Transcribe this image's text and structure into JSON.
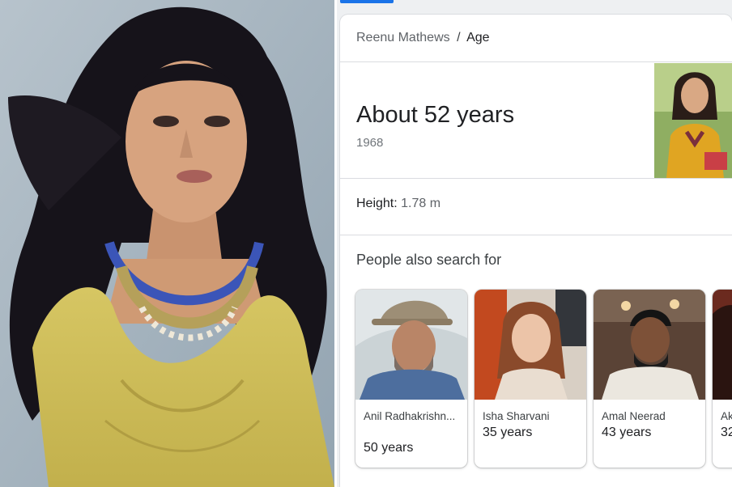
{
  "breadcrumb": {
    "entity": "Reenu Mathews",
    "separator": "/",
    "attribute": "Age"
  },
  "answer": {
    "value": "About 52 years",
    "birth_year": "1968"
  },
  "height": {
    "label": "Height:",
    "value": "1.78 m"
  },
  "pasf": {
    "title": "People also search for",
    "people": [
      {
        "name": "Anil Radhakrishn...",
        "age": "50 years"
      },
      {
        "name": "Isha Sharvani",
        "age": "35 years"
      },
      {
        "name": "Amal Neerad",
        "age": "43 years"
      },
      {
        "name": "Ak",
        "age": "32"
      }
    ]
  },
  "colors": {
    "accent": "#1a73e8",
    "card_border": "#dadce0",
    "secondary_text": "#70757a"
  }
}
